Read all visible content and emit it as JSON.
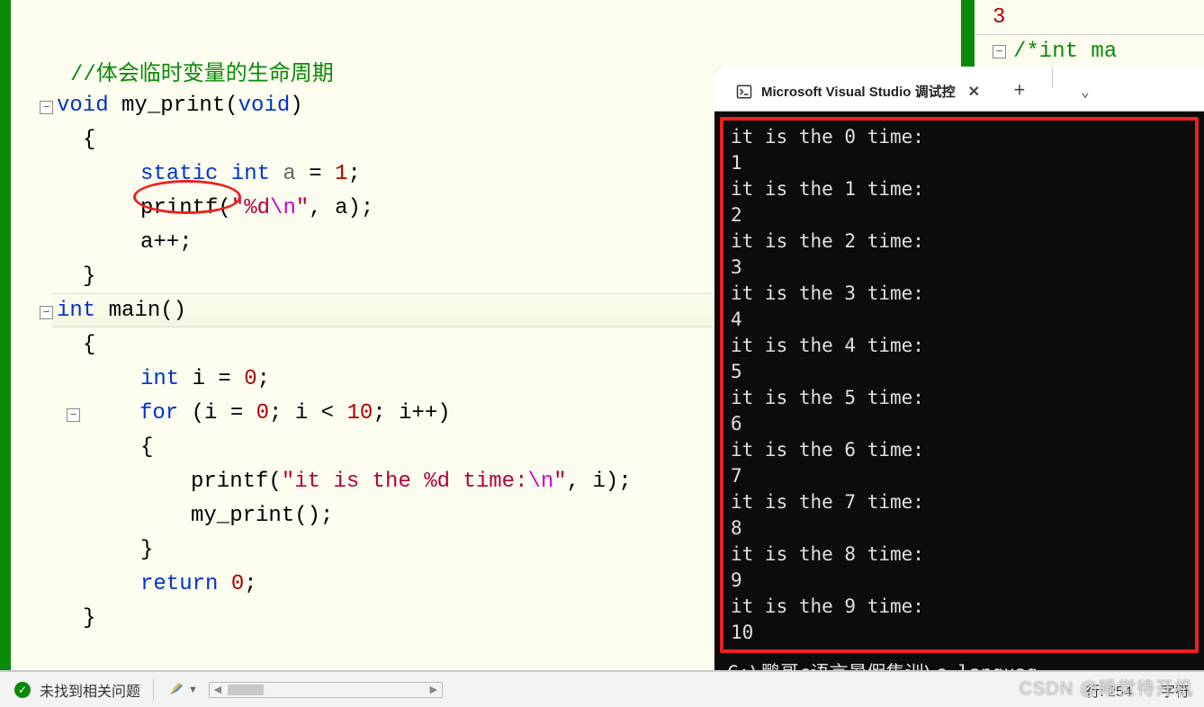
{
  "editor": {
    "comment": "//体会临时变量的生命周期",
    "code": {
      "l1_kw_void": "void",
      "l1_fn": " my_print",
      "l1_paren_open": "(",
      "l1_kw_void2": "void",
      "l1_paren_close": ")",
      "l2_brace": "{",
      "l3_static": "static",
      "l3_int": " int",
      "l3_a": " a ",
      "l3_eq": "= ",
      "l3_1": "1",
      "l3_semi": ";",
      "l4_printf": "printf",
      "l4_po": "(",
      "l4_q1": "\"",
      "l4_fmt": "%d",
      "l4_esc": "\\n",
      "l4_q2": "\"",
      "l4_comma": ", a)",
      "l4_pc": ";",
      "l5_app": "a++;",
      "l6_brace": "}",
      "l7_int": "int",
      "l7_main": " main",
      "l7_par": "()",
      "l8_brace": "{",
      "l9_int": "int",
      "l9_rest": " i = ",
      "l9_0": "0",
      "l9_semi": ";",
      "l10_for": "for",
      "l10_a": " (i = ",
      "l10_0": "0",
      "l10_b": "; i < ",
      "l10_10": "10",
      "l10_c": "; i++)",
      "l11_brace": "{",
      "l12_printf": "printf",
      "l12_po": "(",
      "l12_q1": "\"",
      "l12_str": "it is the %d time:",
      "l12_esc": "\\n",
      "l12_q2": "\"",
      "l12_args": ", i);",
      "l13_call": "my_print();",
      "l14_brace": "}",
      "l15_return": "return",
      "l15_sp": " ",
      "l15_0": "0",
      "l15_semi": ";",
      "l16_brace": "}"
    }
  },
  "console": {
    "tab_title": "Microsoft Visual Studio 调试控",
    "output_lines": [
      "it is the 0 time:",
      "1",
      "it is the 1 time:",
      "2",
      "it is the 2 time:",
      "3",
      "it is the 3 time:",
      "4",
      "it is the 4 time:",
      "5",
      "it is the 5 time:",
      "6",
      "it is the 6 time:",
      "7",
      "it is the 7 time:",
      "8",
      "it is the 8 time:",
      "9",
      "it is the 9 time:",
      "10"
    ],
    "path": "C:\\鹏哥c语言暑假集训\\c-languag"
  },
  "right_snippet": {
    "n3": "3",
    "comment": "/*int ma"
  },
  "status": {
    "issues": "未找到相关问题",
    "row_label": "行: 254",
    "char_label": "字符",
    "watermark": "CSDN @睡觉待开机"
  }
}
